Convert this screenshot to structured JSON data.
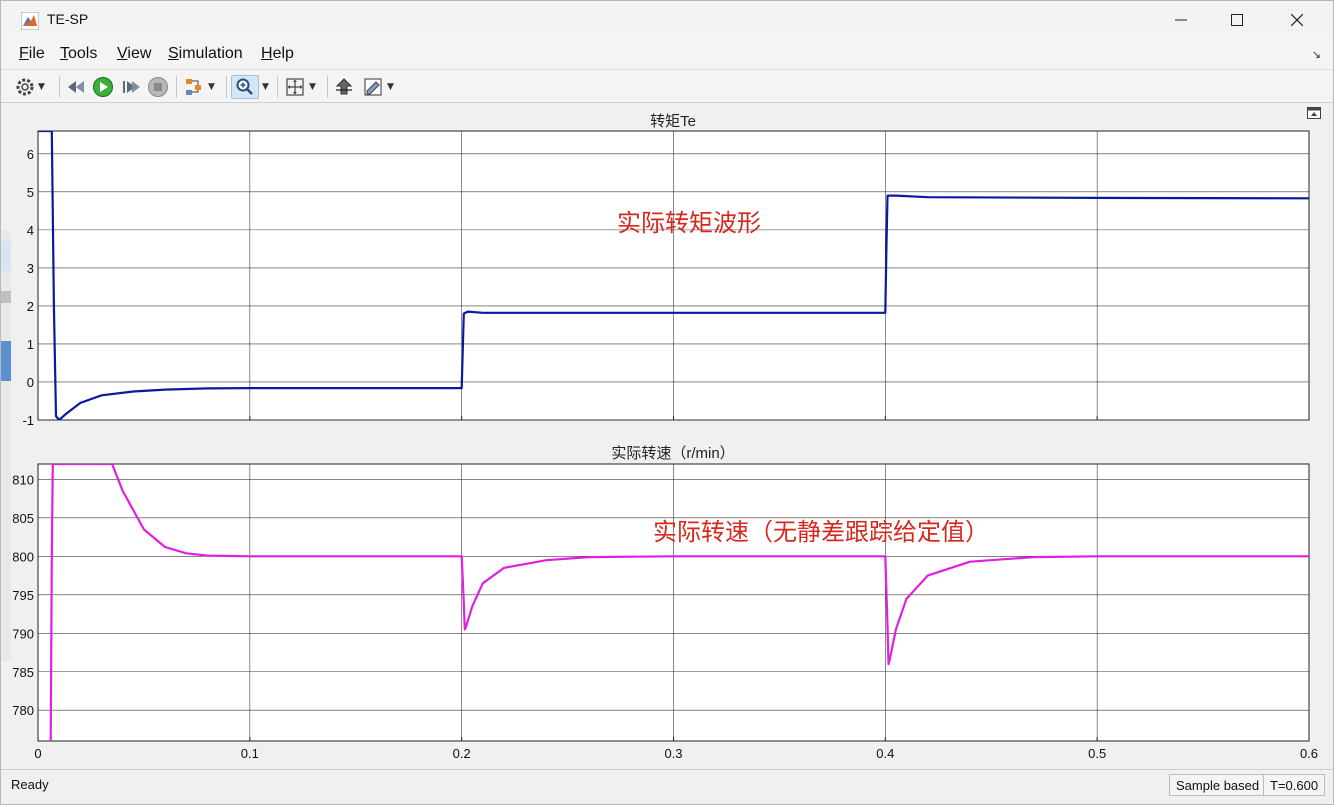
{
  "window": {
    "title": "TE-SP",
    "controls": [
      "minimize",
      "maximize",
      "close"
    ]
  },
  "menu": [
    {
      "label": "File",
      "u": "F",
      "rest": "ile"
    },
    {
      "label": "Tools",
      "u": "T",
      "rest": "ools"
    },
    {
      "label": "View",
      "u": "V",
      "rest": "iew"
    },
    {
      "label": "Simulation",
      "u": "S",
      "rest": "imulation"
    },
    {
      "label": "Help",
      "u": "H",
      "rest": "elp"
    }
  ],
  "toolbar": {
    "icons": [
      "settings-icon",
      "step-back-icon",
      "run-icon",
      "step-forward-icon",
      "stop-icon",
      "highlight-icon",
      "zoom-icon",
      "fit-icon",
      "cursor-measure-icon",
      "style-icon"
    ]
  },
  "colors": {
    "torque_line": "#0a1a9e",
    "speed_line": "#e020e0",
    "annotation": "#d6281e",
    "plot_bg": "#ffffff",
    "grid": "#3a3a3a"
  },
  "chart_data": [
    {
      "type": "line",
      "title": "转矩Te",
      "annotation": "实际转矩波形",
      "xlim": [
        0,
        0.6
      ],
      "ylim": [
        -1,
        6.6
      ],
      "yticks": [
        -1,
        0,
        1,
        2,
        3,
        4,
        5,
        6
      ],
      "ytick_labels": [
        "-1",
        "0",
        "1",
        "2",
        "3",
        "4",
        "5",
        "6"
      ],
      "xticks": [
        0,
        0.1,
        0.2,
        0.3,
        0.4,
        0.5,
        0.6
      ],
      "grid": true,
      "series": [
        {
          "color": "#0a1a9e",
          "x": [
            0,
            0.0065,
            0.0075,
            0.0085,
            0.01,
            0.013,
            0.02,
            0.03,
            0.045,
            0.06,
            0.08,
            0.1,
            0.15,
            0.2,
            0.2005,
            0.201,
            0.203,
            0.21,
            0.3,
            0.4,
            0.4005,
            0.401,
            0.405,
            0.42,
            0.5,
            0.6
          ],
          "y": [
            6.6,
            6.6,
            2.0,
            -0.9,
            -1.0,
            -0.85,
            -0.55,
            -0.35,
            -0.25,
            -0.2,
            -0.17,
            -0.16,
            -0.16,
            -0.16,
            0.8,
            1.8,
            1.85,
            1.82,
            1.82,
            1.82,
            3.5,
            4.9,
            4.9,
            4.86,
            4.84,
            4.83
          ]
        }
      ]
    },
    {
      "type": "line",
      "title": "实际转速（r/min）",
      "annotation": "实际转速（无静差跟踪给定值）",
      "xlim": [
        0,
        0.6
      ],
      "ylim": [
        776,
        812
      ],
      "yticks": [
        780,
        785,
        790,
        795,
        800,
        805,
        810
      ],
      "ytick_labels": [
        "780",
        "785",
        "790",
        "795",
        "800",
        "805",
        "810"
      ],
      "xticks": [
        0,
        0.1,
        0.2,
        0.3,
        0.4,
        0.5,
        0.6
      ],
      "xtick_labels": [
        "0",
        "0.1",
        "0.2",
        "0.3",
        "0.4",
        "0.5",
        "0.6"
      ],
      "grid": true,
      "series": [
        {
          "color": "#e020e0",
          "x": [
            0.006,
            0.0065,
            0.007,
            0.01,
            0.02,
            0.035,
            0.04,
            0.05,
            0.06,
            0.07,
            0.08,
            0.1,
            0.2,
            0.201,
            0.2015,
            0.202,
            0.205,
            0.21,
            0.22,
            0.24,
            0.26,
            0.3,
            0.4,
            0.401,
            0.4015,
            0.402,
            0.405,
            0.41,
            0.42,
            0.44,
            0.47,
            0.5,
            0.6
          ],
          "y": [
            776,
            800,
            812,
            812,
            812,
            812,
            808.5,
            803.5,
            801.2,
            800.4,
            800.1,
            800,
            800,
            794,
            790.5,
            790.8,
            793.5,
            796.5,
            798.5,
            799.5,
            799.9,
            800,
            800,
            791,
            786,
            786.5,
            790.5,
            794.5,
            797.5,
            799.3,
            799.9,
            800,
            800
          ]
        }
      ]
    }
  ],
  "status": {
    "ready": "Ready",
    "mode": "Sample based",
    "time": "T=0.600"
  }
}
